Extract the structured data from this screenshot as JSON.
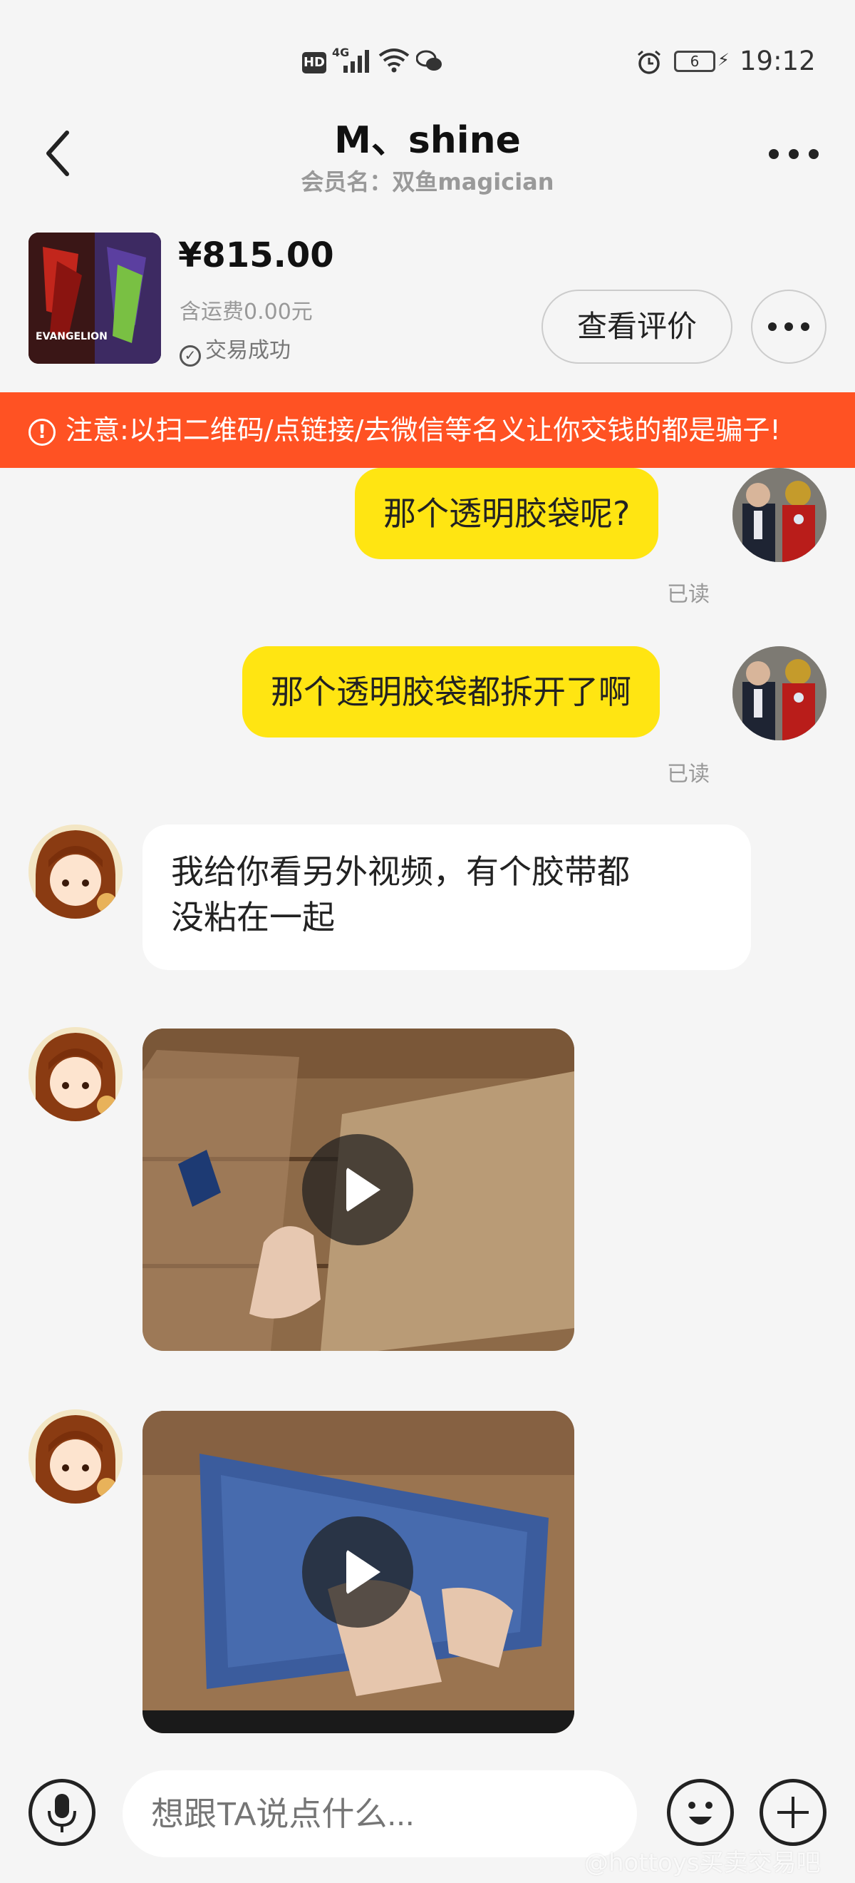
{
  "status_bar": {
    "hd": "HD",
    "network": "4G",
    "battery": "6",
    "time": "19:12"
  },
  "header": {
    "title": "M、shine",
    "subtitle": "会员名：双鱼magician"
  },
  "product": {
    "thumb_text": "EVANGELION",
    "price": "¥815.00",
    "shipping": "含运费0.00元",
    "status": "交易成功",
    "review_button": "查看评价"
  },
  "warning": {
    "text": "注意:以扫二维码/点链接/去微信等名义让你交钱的都是骗子!"
  },
  "messages": [
    {
      "from": "me",
      "text": "那个透明胶袋呢?",
      "read": "已读"
    },
    {
      "from": "me",
      "text": "那个透明胶袋都拆开了啊",
      "read": "已读"
    },
    {
      "from": "other",
      "line1": "我给你看另外视频，有个胶带都",
      "line2": "没粘在一起"
    }
  ],
  "videos": [
    {
      "caption": ""
    },
    {
      "caption": ""
    }
  ],
  "input": {
    "placeholder": "想跟TA说点什么..."
  },
  "watermark": "@hottoys买卖交易吧",
  "colors": {
    "my_bubble": "#ffe512",
    "warning_bg": "#ff5223",
    "background": "#f5f5f5"
  },
  "icons": [
    "back-icon",
    "more-icon",
    "check-circle-icon",
    "exclamation-icon",
    "play-icon",
    "microphone-icon",
    "emoji-icon",
    "plus-icon"
  ]
}
